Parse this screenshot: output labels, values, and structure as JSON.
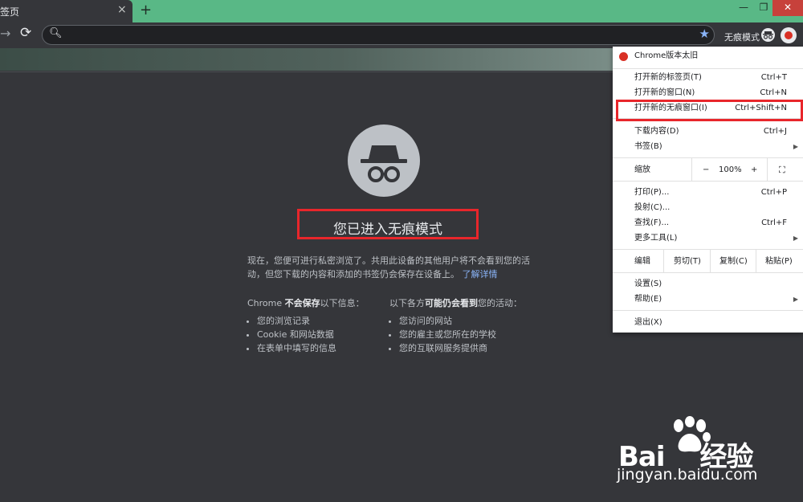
{
  "browser": {
    "tab_title": "签页",
    "tab_close": "×",
    "new_tab": "+",
    "window_min": "—",
    "window_max": "❐",
    "window_close": "✕",
    "nav_forward": "→",
    "nav_reload": "⟳",
    "omnibox_value": "",
    "incognito_label": "无痕模式"
  },
  "incognito_page": {
    "title": "您已进入无痕模式",
    "description": "现在，您便可进行私密浏览了。共用此设备的其他用户将不会看到您的活动，但您下载的内容和添加的书签仍会保存在设备上。",
    "learn_more": "了解详情",
    "not_saved_prefix": "Chrome ",
    "not_saved_bold": "不会保存",
    "not_saved_suffix": "以下信息：",
    "not_saved_items": [
      "您的浏览记录",
      "Cookie 和网站数据",
      "在表单中填写的信息"
    ],
    "visible_prefix": "以下各方",
    "visible_bold": "可能仍会看到",
    "visible_suffix": "您的活动：",
    "visible_items": [
      "您访问的网站",
      "您的雇主或您所在的学校",
      "您的互联网服务提供商"
    ]
  },
  "menu": {
    "update_notice": "Chrome版本太旧",
    "items_group1": [
      {
        "label": "打开新的标签页(T)",
        "shortcut": "Ctrl+T"
      },
      {
        "label": "打开新的窗口(N)",
        "shortcut": "Ctrl+N"
      },
      {
        "label": "打开新的无痕窗口(I)",
        "shortcut": "Ctrl+Shift+N"
      }
    ],
    "items_group2": [
      {
        "label": "下载内容(D)",
        "shortcut": "Ctrl+J"
      },
      {
        "label": "书签(B)",
        "shortcut": ""
      }
    ],
    "zoom_label": "缩放",
    "zoom_minus": "−",
    "zoom_value": "100%",
    "zoom_plus": "+",
    "zoom_fullscreen": "⛶",
    "items_group3": [
      {
        "label": "打印(P)...",
        "shortcut": "Ctrl+P"
      },
      {
        "label": "投射(C)...",
        "shortcut": ""
      },
      {
        "label": "查找(F)...",
        "shortcut": "Ctrl+F"
      },
      {
        "label": "更多工具(L)",
        "shortcut": ""
      }
    ],
    "edit_label": "编辑",
    "cut": "剪切(T)",
    "copy": "复制(C)",
    "paste": "粘贴(P)",
    "items_group4": [
      {
        "label": "设置(S)",
        "shortcut": ""
      },
      {
        "label": "帮助(E)",
        "shortcut": ""
      }
    ],
    "exit": "退出(X)",
    "submenu_arrow": "▶"
  },
  "watermark": {
    "brand_left": "Bai",
    "brand_right": "经验",
    "url": "jingyan.baidu.com"
  },
  "colors": {
    "titlebar": "#59b886",
    "page_bg": "#35363a",
    "highlight_box": "#e8262b",
    "link": "#8ab4f8"
  }
}
